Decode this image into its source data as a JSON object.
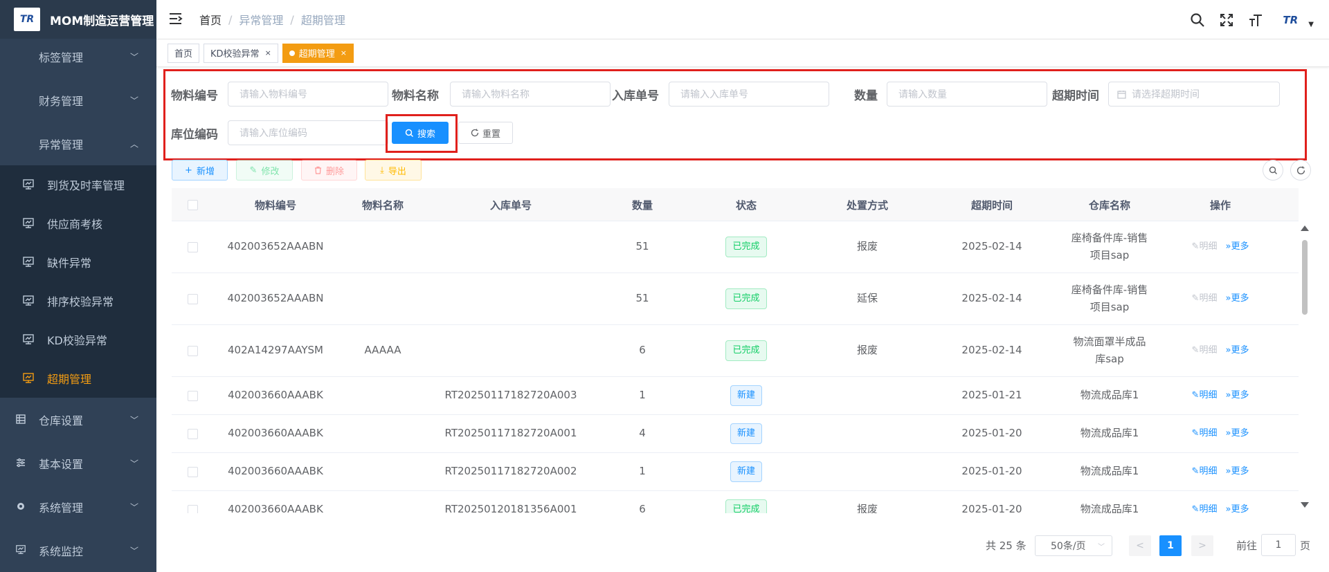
{
  "app": {
    "title": "MOM制造运营管理",
    "logo_text": "TR"
  },
  "sidebar": {
    "top_items": [
      {
        "label": "标签管理"
      },
      {
        "label": "财务管理"
      },
      {
        "label": "异常管理"
      }
    ],
    "sub_items": [
      {
        "label": "到货及时率管理"
      },
      {
        "label": "供应商考核"
      },
      {
        "label": "缺件异常"
      },
      {
        "label": "排序校验异常"
      },
      {
        "label": "KD校验异常"
      },
      {
        "label": "超期管理"
      }
    ],
    "bottom_items": [
      {
        "label": "仓库设置"
      },
      {
        "label": "基本设置"
      },
      {
        "label": "系统管理"
      },
      {
        "label": "系统监控"
      }
    ],
    "active_color": "#f39c12"
  },
  "breadcrumb": {
    "home": "首页",
    "level1": "异常管理",
    "level2": "超期管理",
    "sep": "/"
  },
  "tags": [
    {
      "label": "首页"
    },
    {
      "label": "KD校验异常",
      "close": "×"
    },
    {
      "label": "超期管理",
      "close": "×"
    }
  ],
  "search": {
    "fields": [
      {
        "label": "物料编号",
        "placeholder": "请输入物料编号"
      },
      {
        "label": "物料名称",
        "placeholder": "请输入物料名称"
      },
      {
        "label": "入库单号",
        "placeholder": "请输入入库单号"
      },
      {
        "label": "数量",
        "placeholder": "请输入数量"
      },
      {
        "label": "超期时间",
        "placeholder": "请选择超期时间"
      },
      {
        "label": "库位编码",
        "placeholder": "请输入库位编码"
      }
    ],
    "search_label": "搜索",
    "reset_label": "重置"
  },
  "toolbar": {
    "add": "新增",
    "edit": "修改",
    "delete": "删除",
    "export": "导出"
  },
  "table": {
    "columns": [
      "物料编号",
      "物料名称",
      "入库单号",
      "数量",
      "状态",
      "处置方式",
      "超期时间",
      "仓库名称",
      "操作"
    ],
    "rows": [
      {
        "code": "402003652AAABN",
        "name": "",
        "order": "",
        "qty": "51",
        "status": "已完成",
        "status_type": "done",
        "method": "报废",
        "date": "2025-02-14",
        "warehouse": "座椅备件库-销售项目sap",
        "detail_enabled": false
      },
      {
        "code": "402003652AAABN",
        "name": "",
        "order": "",
        "qty": "51",
        "status": "已完成",
        "status_type": "done",
        "method": "延保",
        "date": "2025-02-14",
        "warehouse": "座椅备件库-销售项目sap",
        "detail_enabled": false
      },
      {
        "code": "402A14297AAYSM",
        "name": "AAAAA",
        "order": "",
        "qty": "6",
        "status": "已完成",
        "status_type": "done",
        "method": "报废",
        "date": "2025-02-14",
        "warehouse": "物流面罩半成品库sap",
        "detail_enabled": false
      },
      {
        "code": "402003660AAABK",
        "name": "",
        "order": "RT20250117182720A003",
        "qty": "1",
        "status": "新建",
        "status_type": "new",
        "method": "",
        "date": "2025-01-21",
        "warehouse": "物流成品库1",
        "detail_enabled": true
      },
      {
        "code": "402003660AAABK",
        "name": "",
        "order": "RT20250117182720A001",
        "qty": "4",
        "status": "新建",
        "status_type": "new",
        "method": "",
        "date": "2025-01-20",
        "warehouse": "物流成品库1",
        "detail_enabled": true
      },
      {
        "code": "402003660AAABK",
        "name": "",
        "order": "RT20250117182720A002",
        "qty": "1",
        "status": "新建",
        "status_type": "new",
        "method": "",
        "date": "2025-01-20",
        "warehouse": "物流成品库1",
        "detail_enabled": true
      },
      {
        "code": "402003660AAABK",
        "name": "",
        "order": "RT20250120181356A001",
        "qty": "6",
        "status": "已完成",
        "status_type": "done",
        "method": "报废",
        "date": "2025-01-20",
        "warehouse": "物流成品库1",
        "detail_enabled": true
      }
    ],
    "op_detail": "明细",
    "op_more": "更多"
  },
  "pagination": {
    "total_text": "共 25 条",
    "page_size": "50条/页",
    "current": "1",
    "goto_prefix": "前往",
    "goto_value": "1",
    "goto_suffix": "页",
    "prev": "<",
    "next": ">"
  }
}
